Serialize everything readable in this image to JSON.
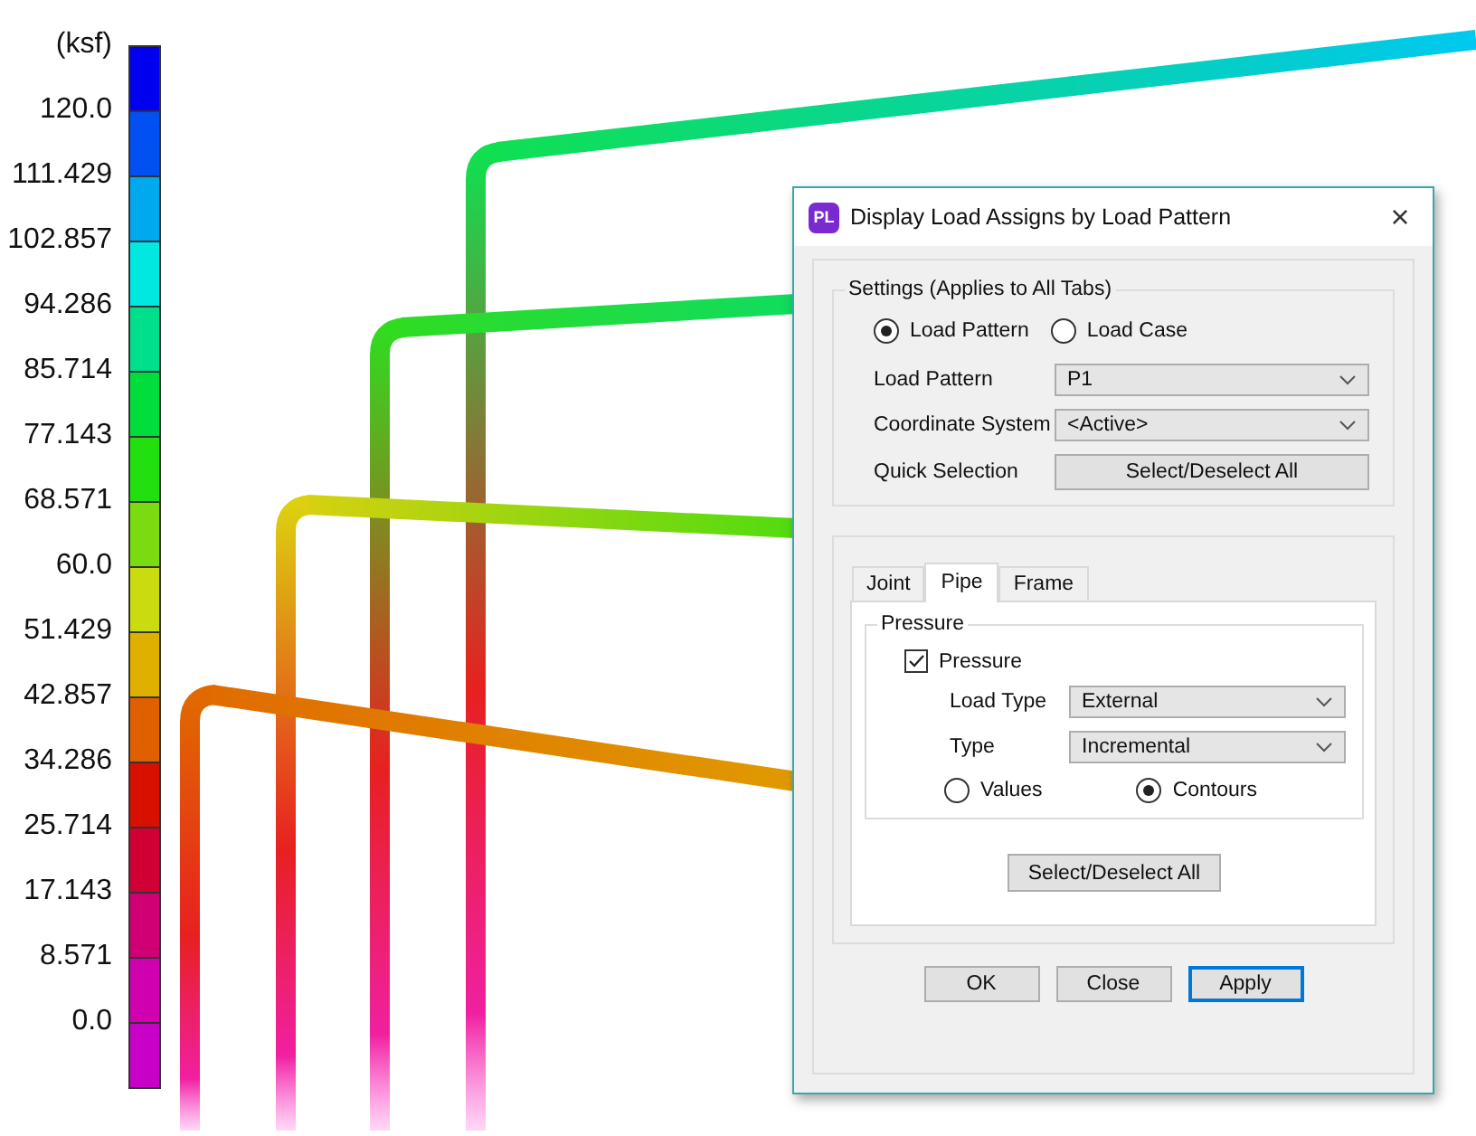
{
  "legend": {
    "unit": "(ksf)",
    "segments": [
      {
        "color": "#0000ee",
        "label": "120.0"
      },
      {
        "color": "#0050f2",
        "label": "111.429"
      },
      {
        "color": "#00a8ee",
        "label": "102.857"
      },
      {
        "color": "#00e8e0",
        "label": "94.286"
      },
      {
        "color": "#00e08c",
        "label": "85.714"
      },
      {
        "color": "#00dd3c",
        "label": "77.143"
      },
      {
        "color": "#22e010",
        "label": "68.571"
      },
      {
        "color": "#7adc10",
        "label": "60.0"
      },
      {
        "color": "#cadc10",
        "label": "51.429"
      },
      {
        "color": "#e0b000",
        "label": "42.857"
      },
      {
        "color": "#e06000",
        "label": "34.286"
      },
      {
        "color": "#d81000",
        "label": "25.714"
      },
      {
        "color": "#d00034",
        "label": "17.143"
      },
      {
        "color": "#d00074",
        "label": "8.571"
      },
      {
        "color": "#d000b0",
        "label": "0.0"
      },
      {
        "color": "#c800c8"
      }
    ]
  },
  "dialog": {
    "app_icon": "PL",
    "title": "Display Load Assigns by Load Pattern",
    "close": "×",
    "settings": {
      "title": "Settings (Applies to All Tabs)",
      "mode": [
        {
          "label": "Load Pattern",
          "selected": true
        },
        {
          "label": "Load Case",
          "selected": false
        }
      ],
      "rows": [
        {
          "kind": "dropdown",
          "label": "Load Pattern",
          "value": "P1"
        },
        {
          "kind": "dropdown",
          "label": "Coordinate System",
          "value": "<Active>"
        },
        {
          "kind": "button",
          "label": "Quick Selection",
          "value": "Select/Deselect All"
        }
      ]
    },
    "tabs": [
      {
        "label": "Joint",
        "selected": false
      },
      {
        "label": "Pipe",
        "selected": true
      },
      {
        "label": "Frame",
        "selected": false
      }
    ],
    "pressure": {
      "title": "Pressure",
      "checkbox": {
        "label": "Pressure",
        "checked": true
      },
      "rows": [
        {
          "kind": "dropdown",
          "label": "Load Type",
          "value": "External"
        },
        {
          "kind": "dropdown",
          "label": "Type",
          "value": "Incremental"
        }
      ],
      "display": [
        {
          "label": "Values",
          "selected": false
        },
        {
          "label": "Contours",
          "selected": true
        }
      ],
      "select_all": "Select/Deselect All"
    },
    "buttons": [
      {
        "label": "OK",
        "focused": false
      },
      {
        "label": "Close",
        "focused": false
      },
      {
        "label": "Apply",
        "focused": true
      }
    ]
  }
}
